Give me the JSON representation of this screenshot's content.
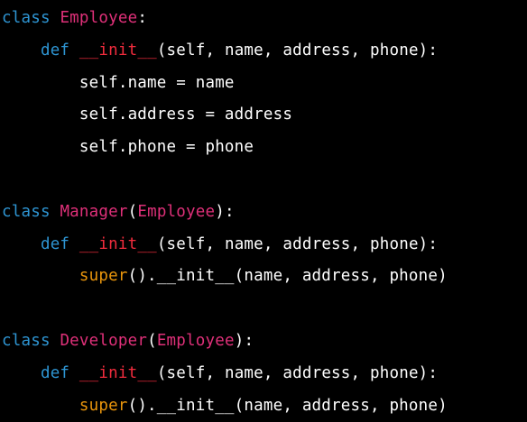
{
  "colors": {
    "background": "#000000",
    "keyword": "#2e95d3",
    "class_name": "#df3079",
    "function": "#f22c3d",
    "builtin": "#e9950c",
    "text": "#ffffff"
  },
  "lines": [
    [
      {
        "text": "class",
        "kind": "keyword"
      },
      {
        "text": " ",
        "kind": "text"
      },
      {
        "text": "Employee",
        "kind": "class_name"
      },
      {
        "text": ":",
        "kind": "text"
      }
    ],
    [
      {
        "text": "    ",
        "kind": "text"
      },
      {
        "text": "def",
        "kind": "keyword"
      },
      {
        "text": " ",
        "kind": "text"
      },
      {
        "text": "__init__",
        "kind": "function"
      },
      {
        "text": "(self, name, address, phone):",
        "kind": "text"
      }
    ],
    [
      {
        "text": "        self.name = name",
        "kind": "text"
      }
    ],
    [
      {
        "text": "        self.address = address",
        "kind": "text"
      }
    ],
    [
      {
        "text": "        self.phone = phone",
        "kind": "text"
      }
    ],
    [],
    [
      {
        "text": "class",
        "kind": "keyword"
      },
      {
        "text": " ",
        "kind": "text"
      },
      {
        "text": "Manager",
        "kind": "class_name"
      },
      {
        "text": "(",
        "kind": "text"
      },
      {
        "text": "Employee",
        "kind": "class_name"
      },
      {
        "text": "):",
        "kind": "text"
      }
    ],
    [
      {
        "text": "    ",
        "kind": "text"
      },
      {
        "text": "def",
        "kind": "keyword"
      },
      {
        "text": " ",
        "kind": "text"
      },
      {
        "text": "__init__",
        "kind": "function"
      },
      {
        "text": "(self, name, address, phone):",
        "kind": "text"
      }
    ],
    [
      {
        "text": "        ",
        "kind": "text"
      },
      {
        "text": "super",
        "kind": "builtin"
      },
      {
        "text": "().__init__(name, address, phone)",
        "kind": "text"
      }
    ],
    [],
    [
      {
        "text": "class",
        "kind": "keyword"
      },
      {
        "text": " ",
        "kind": "text"
      },
      {
        "text": "Developer",
        "kind": "class_name"
      },
      {
        "text": "(",
        "kind": "text"
      },
      {
        "text": "Employee",
        "kind": "class_name"
      },
      {
        "text": "):",
        "kind": "text"
      }
    ],
    [
      {
        "text": "    ",
        "kind": "text"
      },
      {
        "text": "def",
        "kind": "keyword"
      },
      {
        "text": " ",
        "kind": "text"
      },
      {
        "text": "__init__",
        "kind": "function"
      },
      {
        "text": "(self, name, address, phone):",
        "kind": "text"
      }
    ],
    [
      {
        "text": "        ",
        "kind": "text"
      },
      {
        "text": "super",
        "kind": "builtin"
      },
      {
        "text": "().__init__(name, address, phone)",
        "kind": "text"
      }
    ]
  ]
}
